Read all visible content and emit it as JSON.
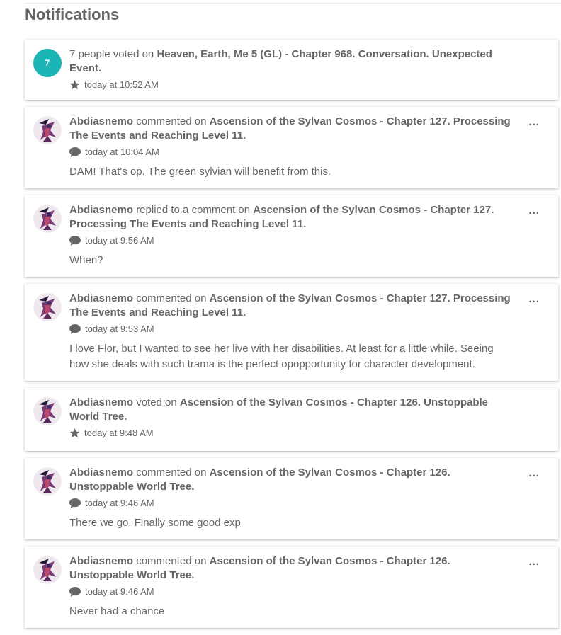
{
  "page": {
    "title": "Notifications"
  },
  "notifications": [
    {
      "badge": "7",
      "actor": "",
      "action": "7 people voted on",
      "target": "Heaven, Earth, Me 5 (GL) - Chapter 968. Conversation. Unexpected Event.",
      "time": "today at 10:52 AM",
      "icon": "star-icon",
      "comment": ""
    },
    {
      "actor": "Abdiasnemo",
      "action": "commented on",
      "target": "Ascension of the Sylvan Cosmos - Chapter 127. Processing The Events and Reaching Level 11.",
      "time": "today at 10:04 AM",
      "icon": "comment-icon",
      "comment": "DAM! That's op. The green sylvian will benefit from this."
    },
    {
      "actor": "Abdiasnemo",
      "action": "replied to a comment on",
      "target": "Ascension of the Sylvan Cosmos - Chapter 127. Processing The Events and Reaching Level 11.",
      "time": "today at 9:56 AM",
      "icon": "comment-icon",
      "comment": "When?"
    },
    {
      "actor": "Abdiasnemo",
      "action": "commented on",
      "target": "Ascension of the Sylvan Cosmos - Chapter 127. Processing The Events and Reaching Level 11.",
      "time": "today at 9:53 AM",
      "icon": "comment-icon",
      "comment": "I love Flor, but I wanted to see her live with her disabilities. At least for a little while. Seeing how she deals with such trama is the perfect opopportunity for character development."
    },
    {
      "actor": "Abdiasnemo",
      "action": "voted on",
      "target": "Ascension of the Sylvan Cosmos - Chapter 126. Unstoppable World Tree.",
      "time": "today at 9:48 AM",
      "icon": "star-icon",
      "comment": ""
    },
    {
      "actor": "Abdiasnemo",
      "action": "commented on",
      "target": "Ascension of the Sylvan Cosmos - Chapter 126. Unstoppable World Tree.",
      "time": "today at 9:46 AM",
      "icon": "comment-icon",
      "comment": "There we go. Finally some good exp"
    },
    {
      "actor": "Abdiasnemo",
      "action": "commented on",
      "target": "Ascension of the Sylvan Cosmos - Chapter 126. Unstoppable World Tree.",
      "time": "today at 9:46 AM",
      "icon": "comment-icon",
      "comment": "Never had a chance"
    }
  ],
  "more_label": "...",
  "colors": {
    "badge": "#1bb5b5",
    "text": "#666666"
  }
}
